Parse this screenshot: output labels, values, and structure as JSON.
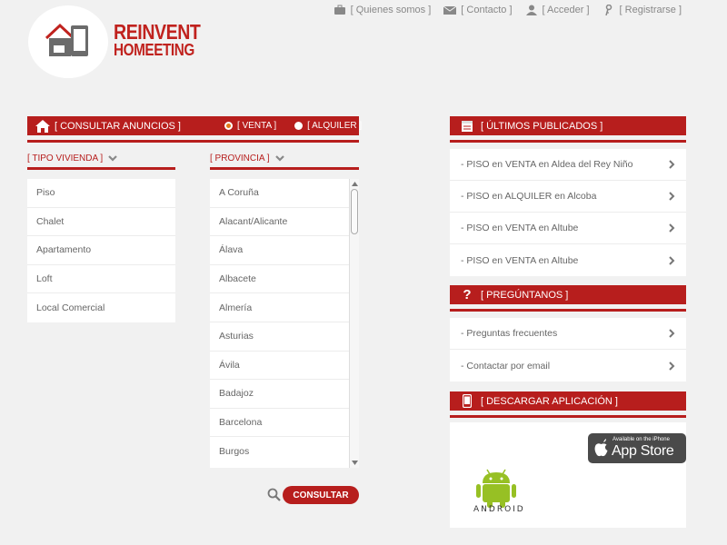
{
  "nav": {
    "items": [
      {
        "label": "[ Quienes somos ]",
        "icon": "briefcase-icon"
      },
      {
        "label": "[ Contacto ]",
        "icon": "envelope-icon"
      },
      {
        "label": "[ Acceder ]",
        "icon": "user-icon"
      },
      {
        "label": "[ Registrarse ]",
        "icon": "key-icon"
      }
    ]
  },
  "logo": {
    "line1": "REINVENT",
    "line2": "HOMEETING"
  },
  "consult": {
    "title": "[ CONSULTAR ANUNCIOS ]",
    "radio_sale": "[ VENTA ]",
    "radio_rent": "[ ALQUILER ]",
    "selected": "VENTA",
    "button": "CONSULTAR"
  },
  "tipo": {
    "label": "[ TIPO VIVIENDA ]",
    "items": [
      "Piso",
      "Chalet",
      "Apartamento",
      "Loft",
      "Local Comercial"
    ]
  },
  "provincia": {
    "label": "[ PROVINCIA ]",
    "items": [
      "A Coruña",
      "Alacant/Alicante",
      "Álava",
      "Albacete",
      "Almería",
      "Asturias",
      "Ávila",
      "Badajoz",
      "Barcelona",
      "Burgos"
    ]
  },
  "ultimos": {
    "title": "[ ÚLTIMOS PUBLICADOS ]",
    "items": [
      "- PISO en VENTA en Aldea del Rey Niño",
      "- PISO en ALQUILER en Alcoba",
      "- PISO en VENTA en Altube",
      "- PISO en VENTA en Altube"
    ]
  },
  "preguntanos": {
    "title": "[ PREGÚNTANOS ]",
    "items": [
      "- Preguntas frecuentes",
      "- Contactar por email"
    ]
  },
  "descargar": {
    "title": "[ DESCARGAR APLICACIÓN ]",
    "appstore_small": "Available on the iPhone",
    "appstore_big": "App Store",
    "android_label": "ANDROID"
  },
  "colors": {
    "accent": "#b71e1d",
    "radio_selected": "#e07a18",
    "android_green": "#97c024"
  }
}
